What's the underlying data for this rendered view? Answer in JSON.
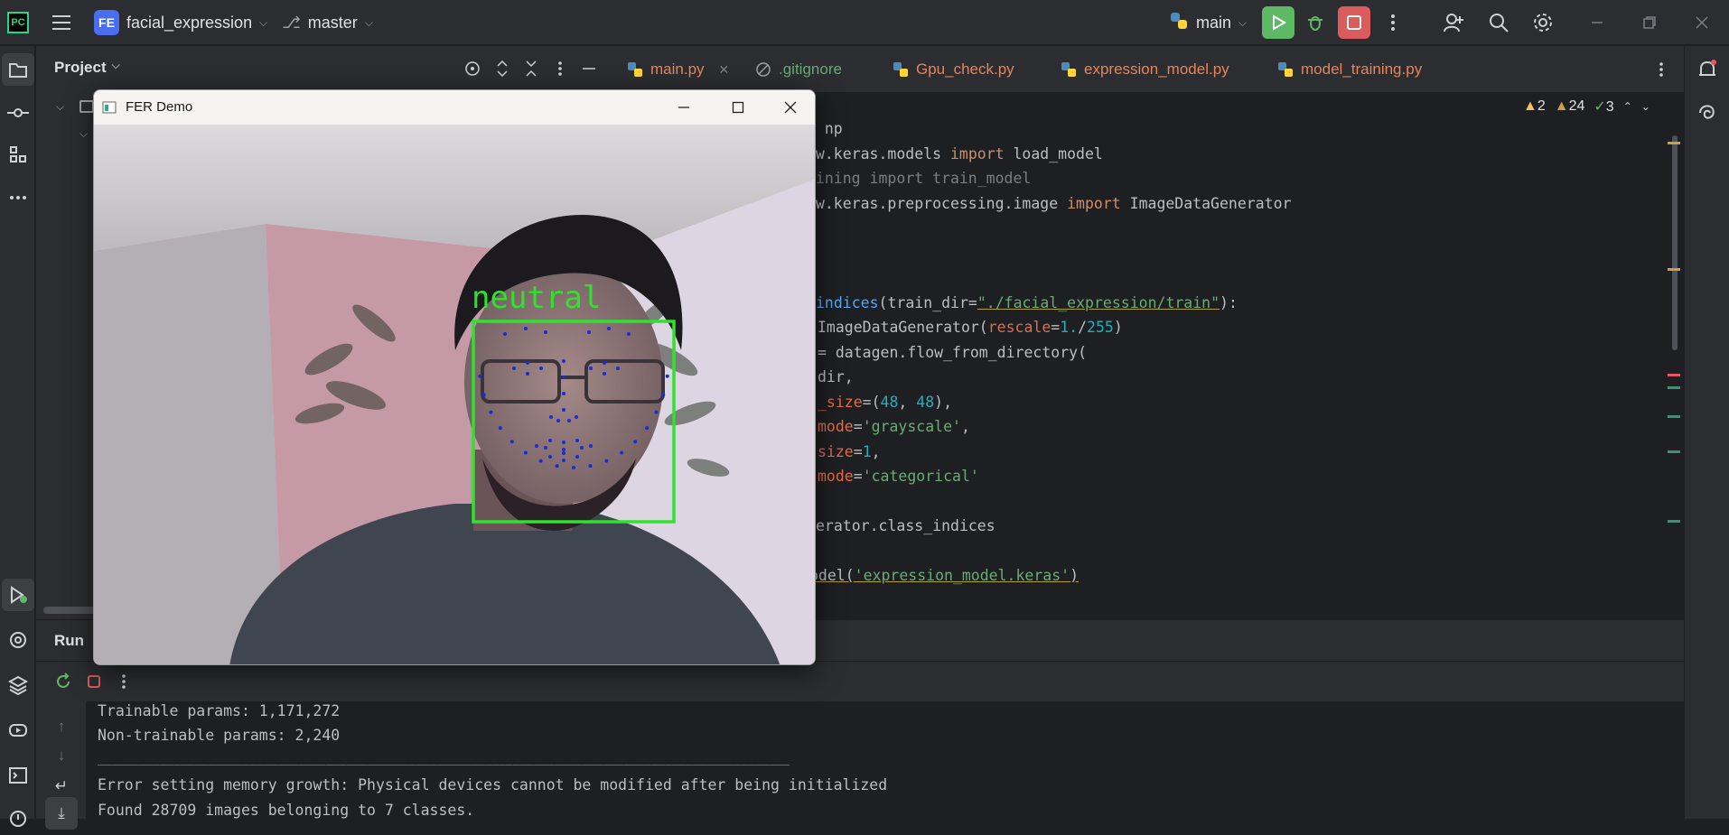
{
  "titlebar": {
    "project_initials": "FE",
    "project_name": "facial_expression",
    "branch": "master",
    "run_config": "main"
  },
  "project_panel": {
    "title": "Project"
  },
  "tabs": [
    {
      "label": "main.py",
      "active": true,
      "color": "#e8845a"
    },
    {
      "label": ".gitignore",
      "color": "#6aab73"
    },
    {
      "label": "Gpu_check.py",
      "color": "#e8845a"
    },
    {
      "label": "expression_model.py",
      "color": "#e8845a"
    },
    {
      "label": "model_training.py",
      "color": "#e8845a"
    }
  ],
  "inspections": {
    "warnings": "2",
    "weak_warnings": "24",
    "typos": "3"
  },
  "code_lines": [
    "s np",
    "ow.keras.models import load_model",
    "aining import train_model",
    "ow.keras.preprocessing.image import ImageDataGenerator",
    "indices(train_dir=\"./facial_expression/train\"):",
    "ImageDataGenerator(rescale=1./255)",
    "= datagen.flow_from_directory(",
    "dir,",
    "_size=(48, 48),",
    "mode='grayscale',",
    "size=1,",
    "mode='categorical'",
    "erator.class_indices",
    "odel('expression_model.keras')"
  ],
  "run_panel": {
    "title": "Run",
    "console": [
      "Trainable params: 1,171,272",
      "Non-trainable params: 2,240",
      "____________________________________________________________________________________________________",
      "Error setting memory growth: Physical devices cannot be modified after being initialized",
      "Found 28709 images belonging to 7 classes."
    ]
  },
  "fer_window": {
    "title": "FER Demo",
    "expression_label": "neutral"
  },
  "colors": {
    "accent_green": "#2ee22e",
    "landmark_blue": "#1a2bd8",
    "run_green": "#5fb865",
    "stop_red": "#db5c5c"
  }
}
